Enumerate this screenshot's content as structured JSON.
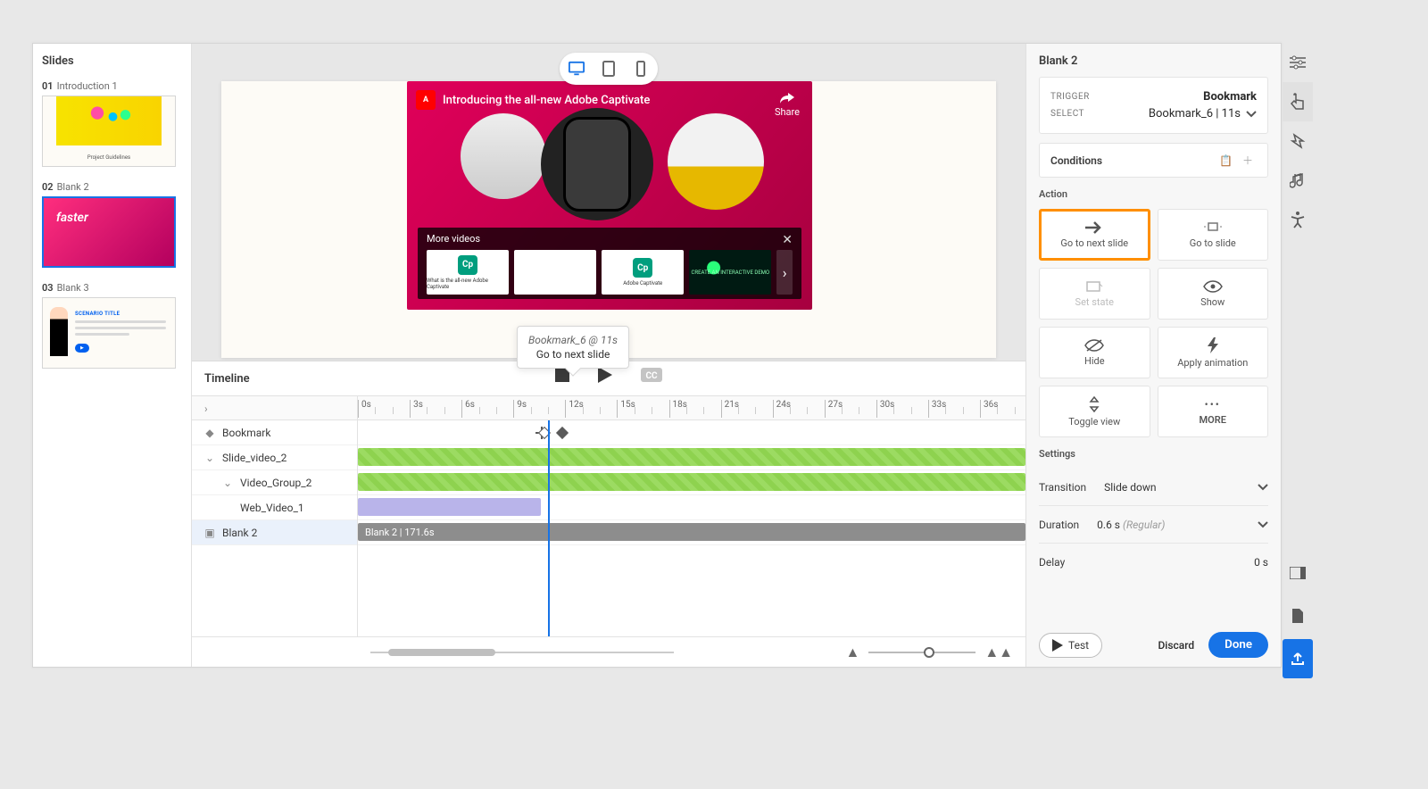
{
  "slidesPanel": {
    "title": "Slides",
    "items": [
      {
        "num": "01",
        "name": "Introduction 1",
        "caption": "Project Guidelines"
      },
      {
        "num": "02",
        "name": "Blank 2",
        "overlay": "faster"
      },
      {
        "num": "03",
        "name": "Blank 3",
        "scenario": "SCENARIO TITLE"
      }
    ],
    "selectedIndex": 1
  },
  "canvas": {
    "video": {
      "title": "Introducing the all-new Adobe Captivate",
      "share": "Share",
      "moreVideos": "More videos",
      "thumbs": [
        {
          "badge": "Cp",
          "caption": "What is the all-new Adobe Captivate",
          "color": "#009e7e"
        },
        {
          "badge": "",
          "caption": "",
          "color": "#ffffff"
        },
        {
          "badge": "Cp",
          "caption": "Adobe Captivate",
          "color": "#009e7e"
        },
        {
          "badge": "",
          "caption": "CREATE AN INTERACTIVE DEMO",
          "dark": true
        }
      ]
    }
  },
  "timeline": {
    "title": "Timeline",
    "tracks": {
      "bookmark": "Bookmark",
      "slideVideo": "Slide_video_2",
      "videoGroup": "Video_Group_2",
      "webVideo": "Web_Video_1",
      "blank": "Blank 2"
    },
    "blankBarLabel": "Blank 2  | 171.6s",
    "ruler": {
      "start": 0,
      "step": 3,
      "count": 12,
      "unit": "s"
    },
    "playheadSeconds": 11,
    "tooltip": {
      "line1": "Bookmark_6  @  11s",
      "line2": "Go to next slide"
    }
  },
  "rightPanel": {
    "title": "Blank 2",
    "trigger": {
      "label": "TRIGGER",
      "value": "Bookmark"
    },
    "select": {
      "label": "SELECT",
      "value": "Bookmark_6 | 11s"
    },
    "conditions": "Conditions",
    "actionHeading": "Action",
    "actions": {
      "goNext": "Go to next slide",
      "goTo": "Go to slide",
      "setState": "Set state",
      "show": "Show",
      "hide": "Hide",
      "applyAnim": "Apply animation",
      "toggleView": "Toggle view",
      "more": "MORE"
    },
    "settingsHeading": "Settings",
    "settings": {
      "transitionLabel": "Transition",
      "transitionValue": "Slide down",
      "durationLabel": "Duration",
      "durationValue": "0.6 s",
      "durationHint": "(Regular)",
      "delayLabel": "Delay",
      "delayValue": "0 s"
    },
    "footer": {
      "test": "Test",
      "discard": "Discard",
      "done": "Done"
    }
  }
}
